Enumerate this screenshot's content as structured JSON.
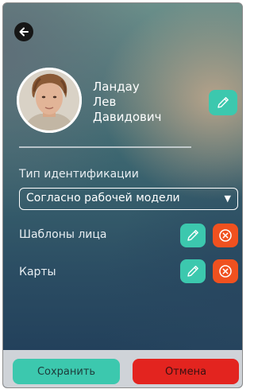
{
  "profile": {
    "name_line1": "Ландау",
    "name_line2": "Лев",
    "name_line3": "Давидович",
    "avatar": "face-photo"
  },
  "form": {
    "identification_type_label": "Тип идентификации",
    "identification_type_value": "Согласно рабочей модели",
    "face_templates_label": "Шаблоны лица",
    "cards_label": "Карты"
  },
  "icons": {
    "back": "arrow-left-icon",
    "edit": "pencil-icon",
    "delete": "circle-x-icon",
    "dropdown": "caret-down-icon"
  },
  "actions": {
    "save_label": "Сохранить",
    "cancel_label": "Отмена"
  },
  "colors": {
    "accent_teal": "#3cc8ae",
    "delete_orange": "#f0511f",
    "cancel_red": "#e3241f"
  }
}
